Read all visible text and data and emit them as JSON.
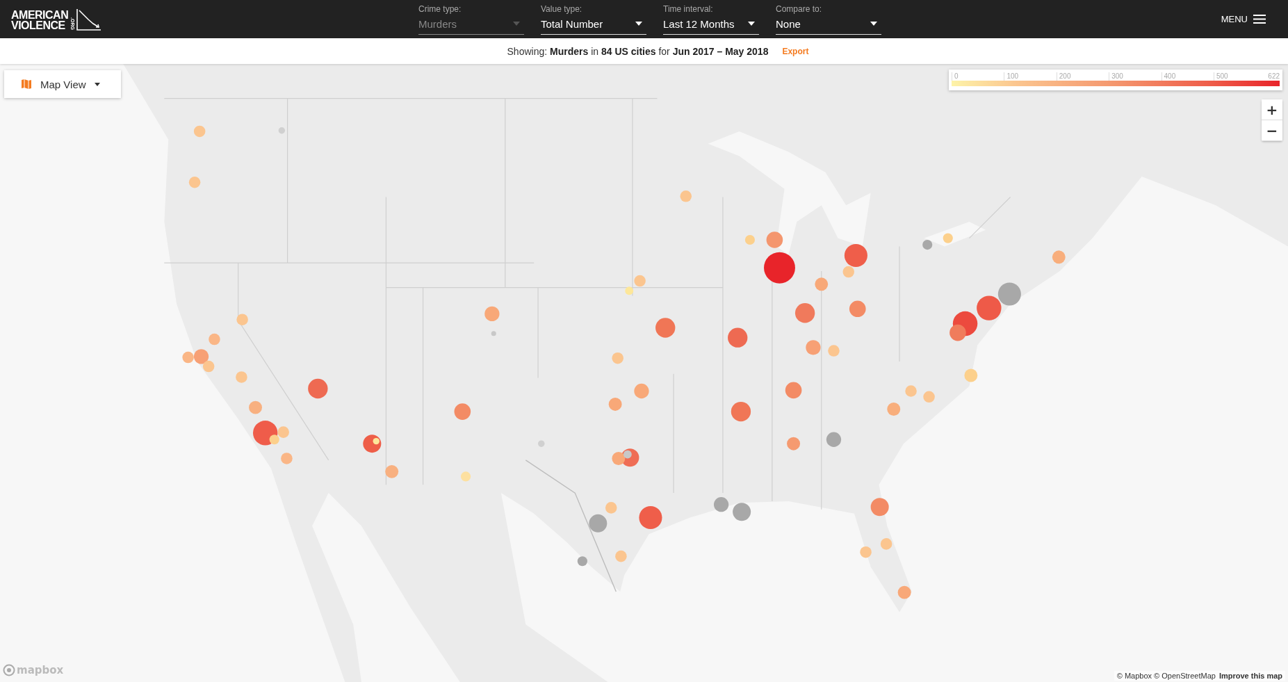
{
  "logo": {
    "lines": [
      "AMERICAN",
      "VIOLENCE"
    ],
    "suffix": ".ORG"
  },
  "filters": [
    {
      "label": "Crime type:",
      "value": "Murders",
      "disabled": true
    },
    {
      "label": "Value type:",
      "value": "Total Number",
      "disabled": false
    },
    {
      "label": "Time interval:",
      "value": "Last 12 Months",
      "disabled": false
    },
    {
      "label": "Compare to:",
      "value": "None",
      "disabled": false
    }
  ],
  "menu": {
    "label": "MENU"
  },
  "summary": {
    "text": "Showing: **Murders** in **84 US cities** for **Jun 2017 – May 2018**",
    "export": "Export"
  },
  "view_switch": {
    "label": "Map View"
  },
  "legend": {
    "ticks": [
      "0",
      "100",
      "200",
      "300",
      "400",
      "500",
      "622"
    ]
  },
  "zoom": {
    "in": "+",
    "out": "−"
  },
  "markers": [
    {
      "color": "#fbc58f"
    },
    {
      "color": "#d0d0d0"
    },
    {
      "color": "#fbc58f"
    },
    {
      "color": "#fbc58f"
    },
    {
      "color": "#fcd08c"
    },
    {
      "color": "#f4966e"
    },
    {
      "color": "#e8242a"
    },
    {
      "color": "#ef5e4a"
    },
    {
      "color": "#fbc58f"
    },
    {
      "color": "#f8a878"
    },
    {
      "color": "#a8a8a8"
    },
    {
      "color": "#fcd08c"
    },
    {
      "color": "#f8ae7c"
    },
    {
      "color": "#a8a8a8"
    },
    {
      "color": "#ee5a48"
    },
    {
      "color": "#ec4a3e"
    },
    {
      "color": "#f07c5c"
    },
    {
      "color": "#f07a5c"
    },
    {
      "color": "#f38b65"
    },
    {
      "color": "#fbc58f"
    },
    {
      "color": "#fde79a"
    },
    {
      "color": "#f8a878"
    },
    {
      "color": "#c8c8c8"
    },
    {
      "color": "#f07656"
    },
    {
      "color": "#ee6a52"
    },
    {
      "color": "#f7a075"
    },
    {
      "color": "#fbc58f"
    },
    {
      "color": "#fbc58f"
    },
    {
      "color": "#fbc58f"
    },
    {
      "color": "#fab686"
    },
    {
      "color": "#f7a075"
    },
    {
      "color": "#fab686"
    },
    {
      "color": "#fbc58f"
    },
    {
      "color": "#fbc58f"
    },
    {
      "color": "#ee6a52"
    },
    {
      "color": "#f38b65"
    },
    {
      "color": "#f8a878"
    },
    {
      "color": "#f8a878"
    },
    {
      "color": "#f38b65"
    },
    {
      "color": "#f07656"
    },
    {
      "color": "#fbc58f"
    },
    {
      "color": "#fbc58f"
    },
    {
      "color": "#f8ae7c"
    },
    {
      "color": "#fcd08c"
    },
    {
      "color": "#f8b080"
    },
    {
      "color": "#ef5c4a"
    },
    {
      "color": "#fbc58f"
    },
    {
      "color": "#fcd08c"
    },
    {
      "color": "#fab686"
    },
    {
      "color": "#ee5e48"
    },
    {
      "color": "#fde79a"
    },
    {
      "color": "#f8b080"
    },
    {
      "color": "#fde0a0"
    },
    {
      "color": "#d0d0d0"
    },
    {
      "color": "#ef6d55"
    },
    {
      "color": "#f8a878"
    },
    {
      "color": "#c8c8c8"
    },
    {
      "color": "#f59a70"
    },
    {
      "color": "#a8a8a8"
    },
    {
      "color": "#fbc58f"
    },
    {
      "color": "#a8a8a8"
    },
    {
      "color": "#ef5e4a"
    },
    {
      "color": "#a8a8a8"
    },
    {
      "color": "#a8a8a8"
    },
    {
      "color": "#a8a8a8"
    },
    {
      "color": "#fbc58f"
    },
    {
      "color": "#f38b65"
    },
    {
      "color": "#fbc58f"
    },
    {
      "color": "#fbc58f"
    },
    {
      "color": "#f8a878"
    }
  ],
  "attribution": {
    "logo": "mapbox",
    "credits": "© Mapbox © OpenStreetMap",
    "improve": "Improve this map"
  }
}
